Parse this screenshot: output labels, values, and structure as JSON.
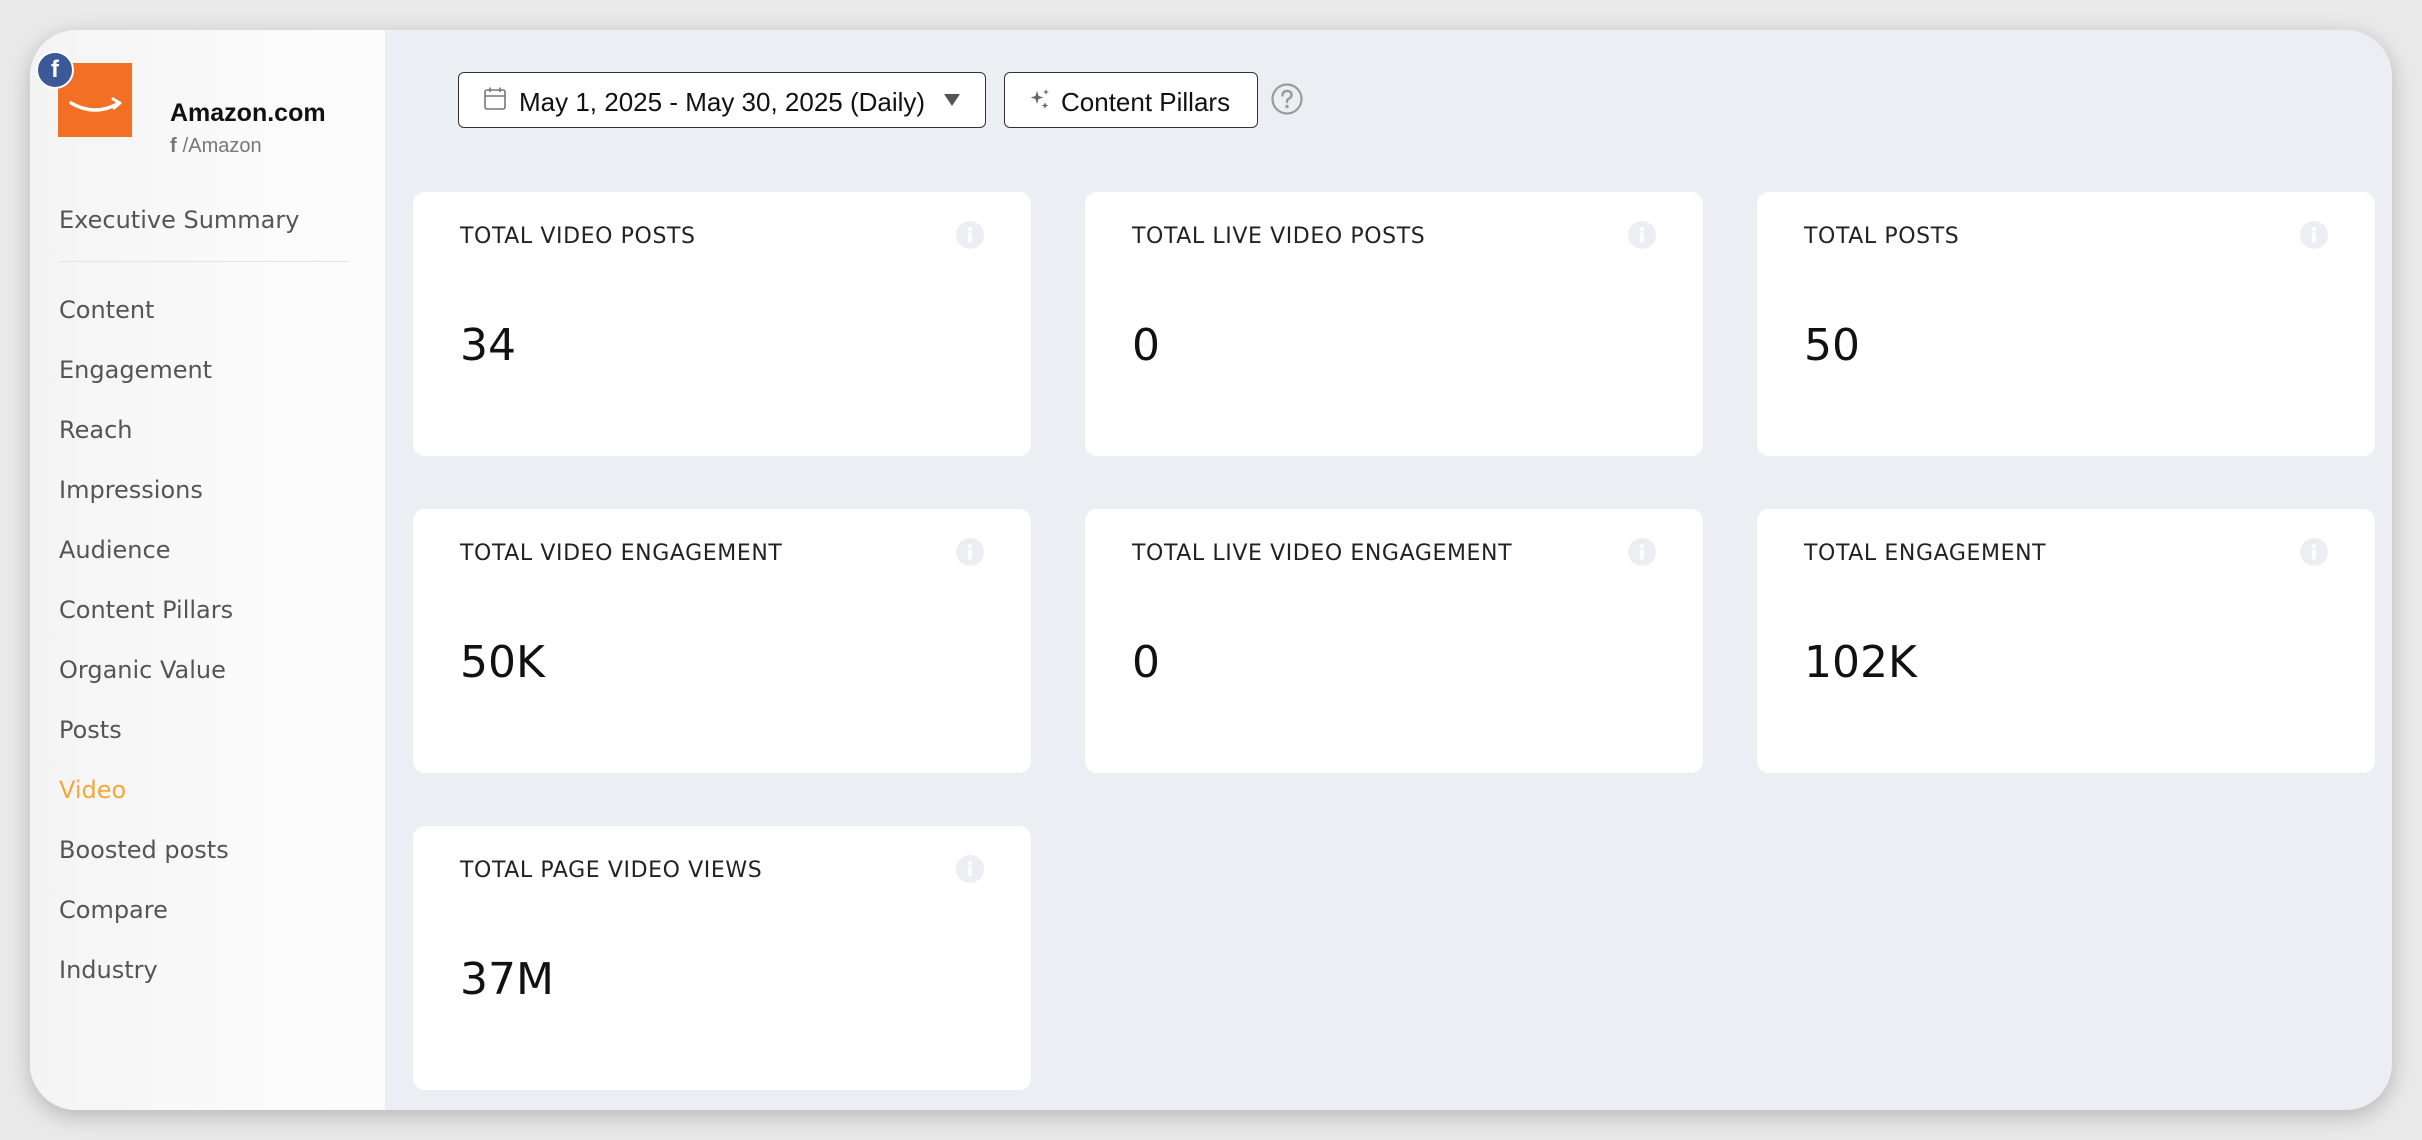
{
  "brand": {
    "name": "Amazon.com",
    "handle": "/Amazon",
    "platform_badge": "f",
    "handle_platform_glyph": "f",
    "logo_color": "#f26f23",
    "badge_color": "#3b5998"
  },
  "sidebar": {
    "items": [
      {
        "label": "Executive Summary",
        "active": false
      },
      {
        "label": "Content",
        "active": false
      },
      {
        "label": "Engagement",
        "active": false
      },
      {
        "label": "Reach",
        "active": false
      },
      {
        "label": "Impressions",
        "active": false
      },
      {
        "label": "Audience",
        "active": false
      },
      {
        "label": "Content Pillars",
        "active": false
      },
      {
        "label": "Organic Value",
        "active": false
      },
      {
        "label": "Posts",
        "active": false
      },
      {
        "label": "Video",
        "active": true
      },
      {
        "label": "Boosted posts",
        "active": false
      },
      {
        "label": "Compare",
        "active": false
      },
      {
        "label": "Industry",
        "active": false
      }
    ],
    "active_color": "#f2a93b"
  },
  "toolbar": {
    "date_range": "May 1, 2025 - May 30, 2025 (Daily)",
    "content_pillars_label": "Content Pillars",
    "icons": [
      "calendar-icon",
      "caret-down-icon",
      "sparkle-icon",
      "help-icon"
    ]
  },
  "cards": [
    {
      "title": "TOTAL VIDEO POSTS",
      "value": "34"
    },
    {
      "title": "TOTAL LIVE VIDEO POSTS",
      "value": "0"
    },
    {
      "title": "TOTAL POSTS",
      "value": "50"
    },
    {
      "title": "TOTAL VIDEO ENGAGEMENT",
      "value": "50K"
    },
    {
      "title": "TOTAL LIVE VIDEO ENGAGEMENT",
      "value": "0"
    },
    {
      "title": "TOTAL ENGAGEMENT",
      "value": "102K"
    },
    {
      "title": "TOTAL PAGE VIDEO VIEWS",
      "value": "37M"
    }
  ]
}
